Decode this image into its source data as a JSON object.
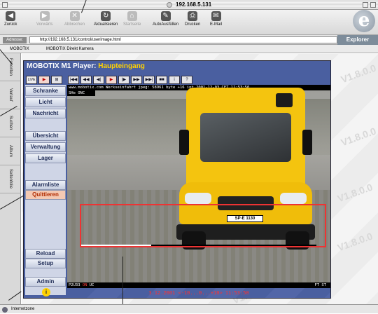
{
  "window": {
    "title": "192.168.5.131"
  },
  "toolbar": {
    "buttons": [
      {
        "label": "Zurück",
        "icon": "back-arrow-icon",
        "enabled": true
      },
      {
        "label": "Vorwärts",
        "icon": "forward-arrow-icon",
        "enabled": false
      },
      {
        "label": "Abbrechen",
        "icon": "stop-icon",
        "enabled": false
      },
      {
        "label": "Aktualisieren",
        "icon": "refresh-icon",
        "enabled": true
      },
      {
        "label": "Startseite",
        "icon": "home-icon",
        "enabled": false
      },
      {
        "label": "AutoAusfüllen",
        "icon": "autofill-icon",
        "enabled": true
      },
      {
        "label": "Drucken",
        "icon": "print-icon",
        "enabled": true
      },
      {
        "label": "E-Mail",
        "icon": "mail-icon",
        "enabled": true
      }
    ],
    "brand_letter": "e"
  },
  "address": {
    "label": "Adresse:",
    "url": "http://192.168.5.131/control/userimage.html",
    "explorer_label": "Explorer"
  },
  "favorites": {
    "items": [
      "MOBOTIX",
      "MOBOTIX Direkt Kamera"
    ]
  },
  "side_tabs": [
    "Favoriten",
    "Verlauf",
    "Suchen",
    "Album",
    "Seitenfolie"
  ],
  "player": {
    "title_prefix": "MOBOTIX M1 Player: ",
    "camera_name": "Haupteingang",
    "controls": [
      "LIVE",
      "▶",
      "⊞",
      "|◀◀",
      "◀◀",
      "◀|",
      "▶",
      "|▶",
      "▶▶",
      "▶▶|",
      "■■",
      "i",
      "?"
    ],
    "menu_items": [
      {
        "label": "Schranke",
        "active": false
      },
      {
        "label": "Licht",
        "active": false
      },
      {
        "label": "Nachricht",
        "active": false
      },
      {
        "label": "Übersicht",
        "active": false
      },
      {
        "label": "Verwaltung",
        "active": false
      },
      {
        "label": "Lager",
        "active": false
      },
      {
        "label": "Alarmliste",
        "active": false
      },
      {
        "label": "Quittieren",
        "active": true
      },
      {
        "label": "Reload",
        "active": false
      },
      {
        "label": "Setup",
        "active": false
      },
      {
        "label": "Admin",
        "active": false
      }
    ],
    "info_label": "i"
  },
  "camera": {
    "overlay_top": "www.mobotix.com Werkseinfahrt jpeg: 58961 byte +16 int  2001-12-03 CET 11:53:50",
    "overlay_second": "SHe ONC",
    "overlay_bottom_left": "P2U33 ",
    "overlay_bottom_red": "ON",
    "overlay_bottom_after": " UC",
    "overlay_bottom_right": "FT ST",
    "plate": "SP-E 1130",
    "footer_caption": "3.12.2001 <-10...0...+10> 11:53:50"
  },
  "status": {
    "text": "Internetzone"
  },
  "watermark": "V1.8.0.0",
  "colors": {
    "player_bg": "#4a5fa0",
    "title_accent": "#ffd200",
    "active_item": "#b02a00",
    "roi": "#e33333",
    "van": "#f4c40f"
  }
}
